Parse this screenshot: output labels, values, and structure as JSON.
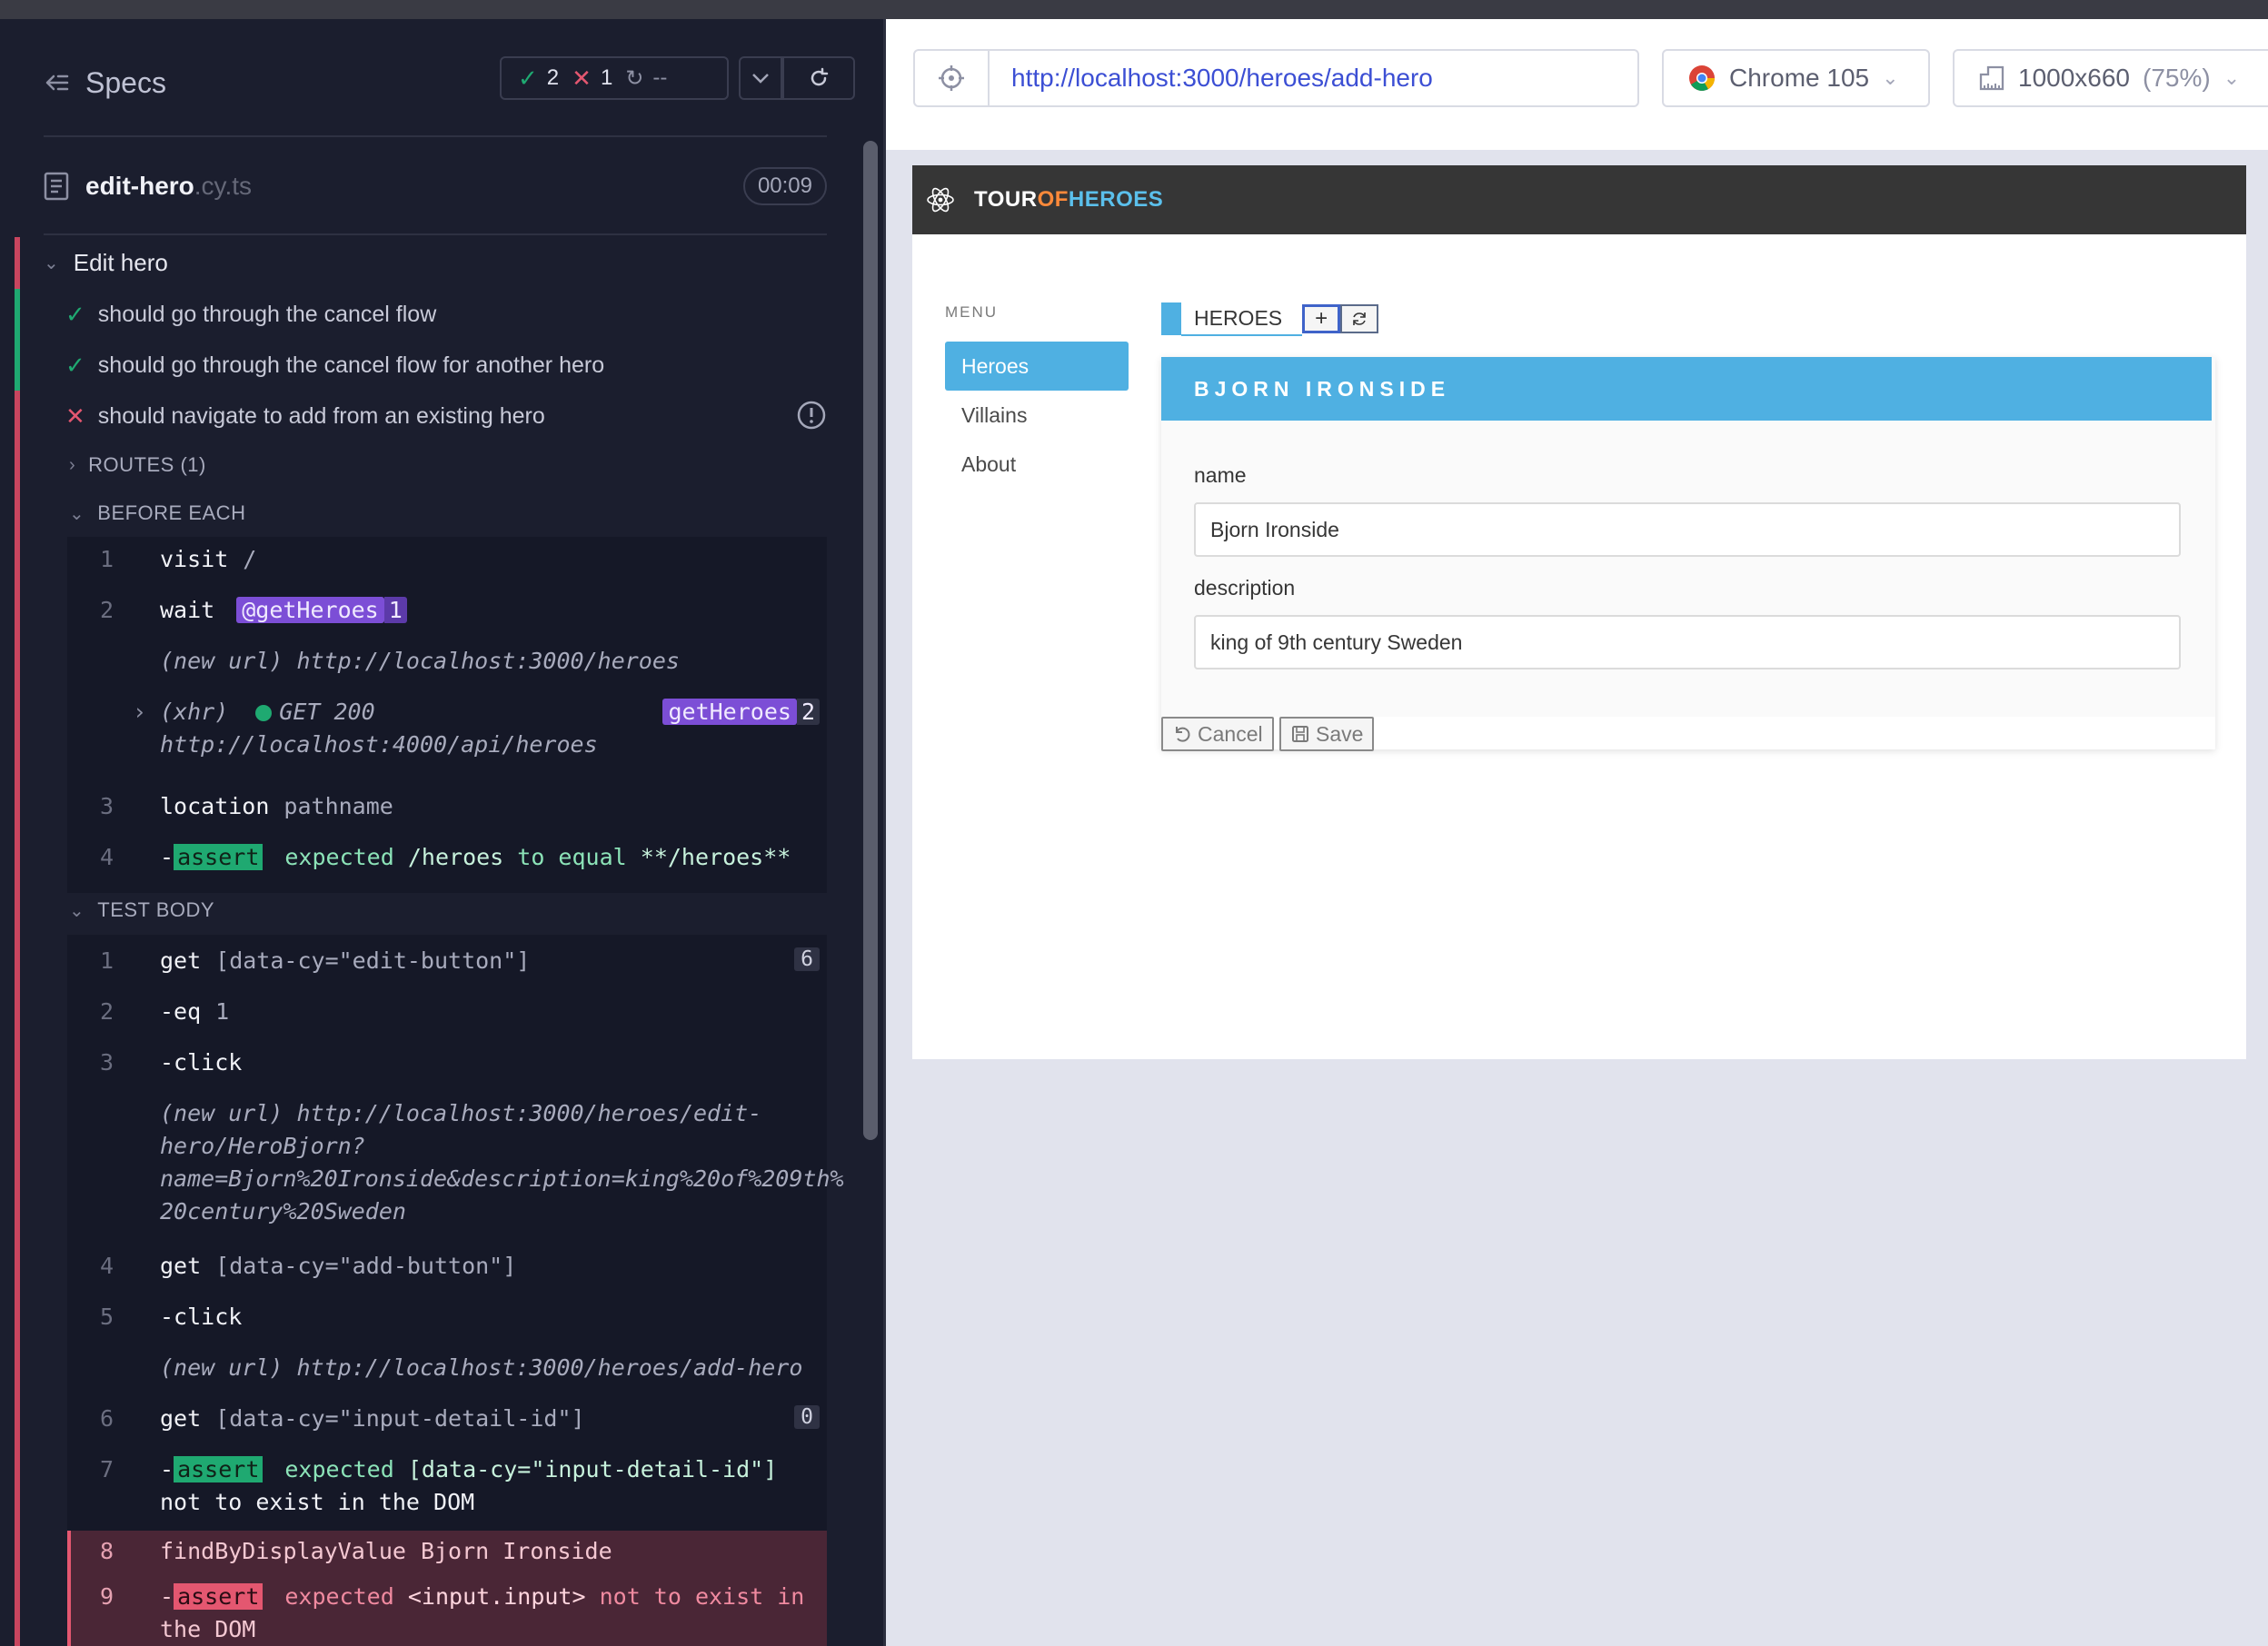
{
  "reporter": {
    "specs_title": "Specs",
    "stats": {
      "passed": "2",
      "failed": "1",
      "pending": "--"
    },
    "file": {
      "name": "edit-hero",
      "ext": ".cy.ts",
      "duration": "00:09"
    },
    "suite": "Edit hero",
    "tests": [
      {
        "title": "should go through the cancel flow",
        "state": "passed"
      },
      {
        "title": "should go through the cancel flow for another hero",
        "state": "passed"
      },
      {
        "title": "should navigate to add from an existing hero",
        "state": "failed"
      }
    ],
    "routes_label": "ROUTES (1)",
    "before_each_label": "BEFORE EACH",
    "test_body_label": "TEST BODY",
    "before_each": {
      "c1": {
        "n": "1",
        "name": "visit",
        "msg": "/"
      },
      "c2": {
        "n": "2",
        "name": "wait",
        "alias": "@getHeroes",
        "alias_n": "1"
      },
      "c2_url": "(new url)  http://localhost:3000/heroes",
      "xhr": {
        "label": "(xhr)",
        "status": "GET 200",
        "url": "http://localhost:4000/api/heroes",
        "alias": "getHeroes",
        "count": "2"
      },
      "c3": {
        "n": "3",
        "name": "location",
        "msg": "pathname"
      },
      "c4": {
        "n": "4",
        "prefix": "-",
        "name": "assert",
        "w1": "expected",
        "w2": "/heroes",
        "w3": "to equal",
        "w4": "**/heroes**"
      }
    },
    "test_body": {
      "c1": {
        "n": "1",
        "name": "get",
        "msg": "[data-cy=\"edit-button\"]",
        "count": "6"
      },
      "c2": {
        "n": "2",
        "name": "-eq",
        "msg": "1"
      },
      "c3": {
        "n": "3",
        "name": "-click"
      },
      "c3_url_1": "(new url)  http://localhost:3000/heroes/edit-",
      "c3_url_2": "hero/HeroBjorn?",
      "c3_url_3": "name=Bjorn%20Ironside&description=king%20of%209th%",
      "c3_url_4": "20century%20Sweden",
      "c4": {
        "n": "4",
        "name": "get",
        "msg": "[data-cy=\"add-button\"]"
      },
      "c5": {
        "n": "5",
        "name": "-click"
      },
      "c5_url": "(new url)  http://localhost:3000/heroes/add-hero",
      "c6": {
        "n": "6",
        "name": "get",
        "msg": "[data-cy=\"input-detail-id\"]",
        "count": "0"
      },
      "c7": {
        "n": "7",
        "prefix": "-",
        "name": "assert",
        "w1": "expected",
        "w2": "[data-cy=\"input-detail-id\"]",
        "w3": "not to exist in the DOM"
      },
      "c8": {
        "n": "8",
        "name": "findByDisplayValue",
        "msg": "Bjorn Ironside"
      },
      "c9": {
        "n": "9",
        "prefix": "-",
        "name": "assert",
        "w1": "expected",
        "w2": "<input.input>",
        "w3": "not to exist in",
        "w4": "the DOM"
      }
    }
  },
  "browser_bar": {
    "url": "http://localhost:3000/heroes/add-hero",
    "browser": "Chrome 105",
    "viewport": "1000x660",
    "viewport_pct": "(75%)"
  },
  "app": {
    "brand": {
      "t1": "TOUR",
      "t2": "OF",
      "t3": "HEROES"
    },
    "menu_label": "MENU",
    "menu": [
      "Heroes",
      "Villains",
      "About"
    ],
    "heroes_header": "HEROES",
    "card_title": "BJORN IRONSIDE",
    "name_label": "name",
    "name_value": "Bjorn Ironside",
    "description_label": "description",
    "description_value": "king of 9th century Sweden",
    "cancel_label": "Cancel",
    "save_label": "Save"
  },
  "colors": {
    "pass": "#1fa971",
    "fail": "#e45770",
    "alias": "#7c4ed6",
    "accent": "#4fb0e2",
    "url": "#3c4fd4"
  }
}
